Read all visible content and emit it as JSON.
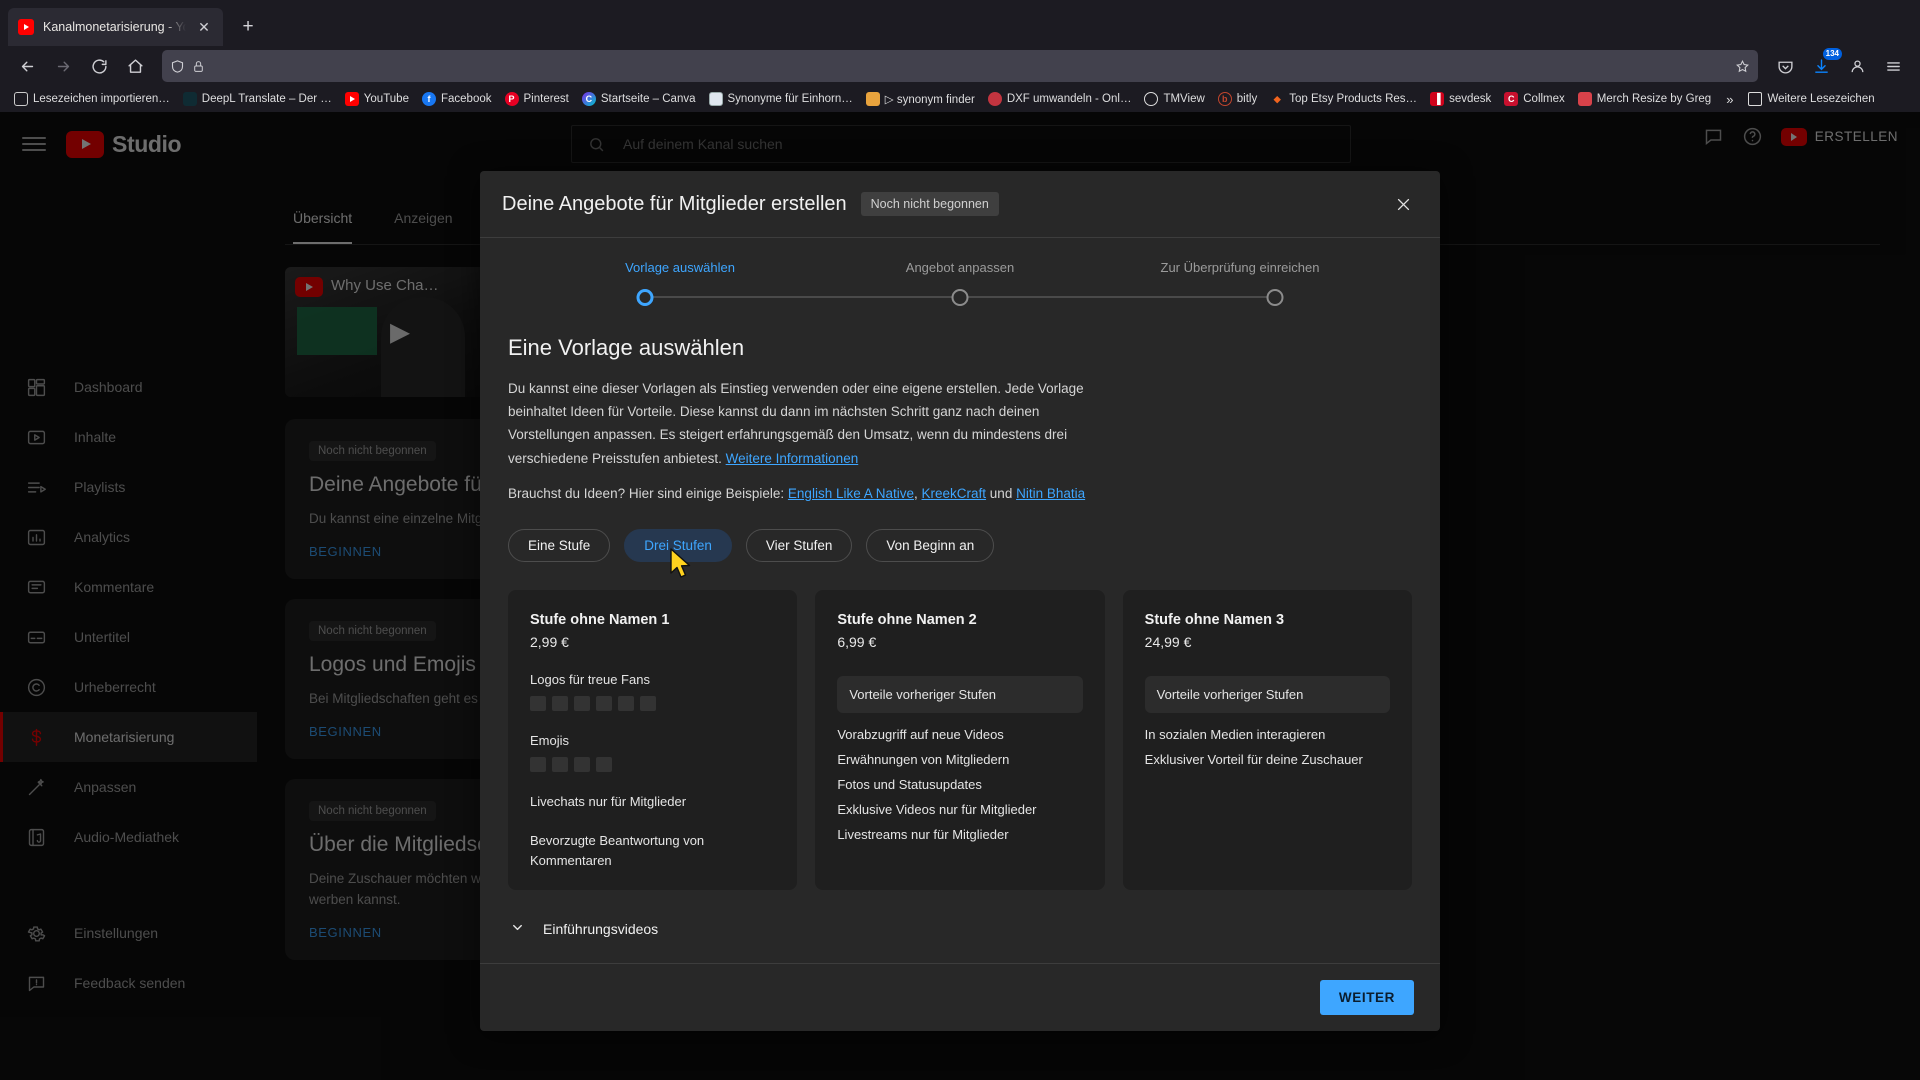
{
  "browser": {
    "tab": {
      "title": "Kanalmonetarisierung - YouTub",
      "close_label": "✕",
      "favicon": "youtube-icon"
    },
    "newtab_label": "+",
    "nav": {
      "back": "←",
      "forward": "→",
      "reload": "↻",
      "home": "⌂"
    },
    "urlbar": {
      "shield_icon": "shield-icon",
      "lock_icon": "lock-icon",
      "bookmark_icon": "star-icon",
      "value": "",
      "placeholder": ""
    },
    "toolbar_right": {
      "pocket": "pocket-icon",
      "downloads": "download-icon",
      "download_count": "134",
      "account": "account-icon",
      "menu": "hamburger-menu-icon"
    },
    "bookmarks": [
      {
        "label": "Lesezeichen importieren…",
        "icon": "import-icon",
        "color": "#00000000"
      },
      {
        "label": "DeepL Translate – Der …",
        "icon": "deepl-icon",
        "color": "#0f2b33"
      },
      {
        "label": "YouTube",
        "icon": "youtube-icon",
        "color": "#ff0000"
      },
      {
        "label": "Facebook",
        "icon": "facebook-icon",
        "color": "#1877f2"
      },
      {
        "label": "Pinterest",
        "icon": "pinterest-icon",
        "color": "#e60023"
      },
      {
        "label": "Startseite – Canva",
        "icon": "canva-icon",
        "color": "#00c4cc"
      },
      {
        "label": "Synonyme für Einhorn…",
        "icon": "book-icon",
        "color": "#dfe6ef"
      },
      {
        "label": "▷ synonym finder",
        "icon": "folder-icon",
        "color": "#e8a33d"
      },
      {
        "label": "DXF umwandeln - Onl…",
        "icon": "dot-icon",
        "color": "#c2343f"
      },
      {
        "label": "TMView",
        "icon": "globe-icon",
        "color": "#00000000"
      },
      {
        "label": "bitly",
        "icon": "bitly-icon",
        "color": "#00000000"
      },
      {
        "label": "Top Etsy Products Res…",
        "icon": "etsy-icon",
        "color": "#f1641e"
      },
      {
        "label": "sevdesk",
        "icon": "chart-icon",
        "color": "#d0021b"
      },
      {
        "label": "Collmex",
        "icon": "collmex-icon",
        "color": "#c8102e"
      },
      {
        "label": "Merch Resize by Greg",
        "icon": "merch-icon",
        "color": "#d8424a"
      }
    ],
    "bookmarks_overflow": "»",
    "bookmarks_more": {
      "label": "Weitere Lesezeichen",
      "icon": "folder-icon"
    }
  },
  "studio": {
    "hamburger": "hamburger-menu-icon",
    "logo_text": "Studio",
    "search": {
      "placeholder": "Auf deinem Kanal suchen",
      "icon": "search-icon"
    },
    "header_right": {
      "feedback_icon": "feedback-icon",
      "help_icon": "help-icon",
      "create_label": "ERSTELLEN",
      "create_icon": "video-record-icon"
    },
    "sidebar": [
      {
        "label": "Dashboard",
        "icon": "dashboard-icon",
        "active": false
      },
      {
        "label": "Inhalte",
        "icon": "content-video-icon",
        "active": false
      },
      {
        "label": "Playlists",
        "icon": "playlist-icon",
        "active": false
      },
      {
        "label": "Analytics",
        "icon": "analytics-bar-icon",
        "active": false
      },
      {
        "label": "Kommentare",
        "icon": "comment-icon",
        "active": false
      },
      {
        "label": "Untertitel",
        "icon": "subtitles-icon",
        "active": false
      },
      {
        "label": "Urheberrecht",
        "icon": "copyright-icon",
        "active": false
      },
      {
        "label": "Monetarisierung",
        "icon": "dollar-icon",
        "active": true
      },
      {
        "label": "Anpassen",
        "icon": "magic-wand-icon",
        "active": false
      },
      {
        "label": "Audio-Mediathek",
        "icon": "audio-library-icon",
        "active": false
      }
    ],
    "sidebar_bottom": [
      {
        "label": "Einstellungen",
        "icon": "gear-icon"
      },
      {
        "label": "Feedback senden",
        "icon": "feedback-icon"
      }
    ],
    "content_tabs": [
      {
        "label": "Übersicht",
        "active": true
      },
      {
        "label": "Anzeigen",
        "active": false
      }
    ],
    "video_card": {
      "title": "Why Use Cha…",
      "badge": "youtube-icon",
      "play": "▶"
    },
    "bg_cards": [
      {
        "chip": "Noch nicht begonnen",
        "heading": "Deine Angebote für",
        "body": "Du kannst eine einzelne Mitglied… anbieten. Überlege dir einzigar… kannst.",
        "action": "BEGINNEN"
      },
      {
        "chip": "Noch nicht begonnen",
        "heading": "Logos und Emojis h",
        "body": "Bei Mitgliedschaften geht es u… die Mitgliedern vorbehalten sin… Livechat aus der Masse hervor…",
        "action": "BEGINNEN"
      },
      {
        "chip": "Noch nicht begonnen",
        "heading": "Über die Mitgliedsc",
        "body": "Deine Zuschauer möchten wa… Kanalmitgliedschaft ist und w… an, wie du für die Mitgliedschaft auf deinem Kanal werben kannst.",
        "action": "BEGINNEN"
      }
    ]
  },
  "modal": {
    "title": "Deine Angebote für Mitglieder erstellen",
    "status_chip": "Noch nicht begonnen",
    "close_icon": "close-icon",
    "steps": [
      {
        "label": "Vorlage auswählen",
        "current": true
      },
      {
        "label": "Angebot anpassen",
        "current": false
      },
      {
        "label": "Zur Überprüfung einreichen",
        "current": false
      }
    ],
    "heading": "Eine Vorlage auswählen",
    "paragraph": "Du kannst eine dieser Vorlagen als Einstieg verwenden oder eine eigene erstellen. Jede Vorlage beinhaltet Ideen für Vorteile. Diese kannst du dann im nächsten Schritt ganz nach deinen Vorstellungen anpassen. Es steigert erfahrungsgemäß den Umsatz, wenn du mindestens drei verschiedene Preisstufen anbietest. ",
    "paragraph_link": "Weitere Informationen",
    "examples_prefix": "Brauchst du Ideen? Hier sind einige Beispiele: ",
    "examples": [
      {
        "label": "English Like A Native",
        "sep": ", "
      },
      {
        "label": "KreekCraft",
        "sep": " und "
      },
      {
        "label": "Nitin Bhatia",
        "sep": ""
      }
    ],
    "chips": [
      {
        "label": "Eine Stufe",
        "selected": false
      },
      {
        "label": "Drei Stufen",
        "selected": true
      },
      {
        "label": "Vier Stufen",
        "selected": false
      },
      {
        "label": "Von Beginn an",
        "selected": false
      }
    ],
    "tiers": [
      {
        "name": "Stufe ohne Namen 1",
        "price": "2,99 €",
        "banner": null,
        "groups": [
          {
            "label": "Logos für treue Fans",
            "squares": 6
          },
          {
            "label": "Emojis",
            "squares": 4
          }
        ],
        "perks": [
          "Livechats nur für Mitglieder",
          "Bevorzugte Beantwortung von Kommentaren"
        ]
      },
      {
        "name": "Stufe ohne Namen 2",
        "price": "6,99 €",
        "banner": "Vorteile vorheriger Stufen",
        "groups": [],
        "perks": [
          "Vorabzugriff auf neue Videos",
          "Erwähnungen von Mitgliedern",
          "Fotos und Statusupdates",
          "Exklusive Videos nur für Mitglieder",
          "Livestreams nur für Mitglieder"
        ]
      },
      {
        "name": "Stufe ohne Namen 3",
        "price": "24,99 €",
        "banner": "Vorteile vorheriger Stufen",
        "groups": [],
        "perks": [
          "In sozialen Medien interagieren",
          "Exklusiver Vorteil für deine Zuschauer"
        ]
      }
    ],
    "accordion": {
      "label": "Einführungsvideos",
      "chevron": "chevron-down-icon"
    },
    "next_button": "WEITER"
  },
  "colors": {
    "accent_blue": "#3ea6ff",
    "youtube_red": "#ff0000",
    "modal_bg": "#282828",
    "page_bg": "#0f0f0f",
    "chrome_bg": "#1c1b22"
  }
}
